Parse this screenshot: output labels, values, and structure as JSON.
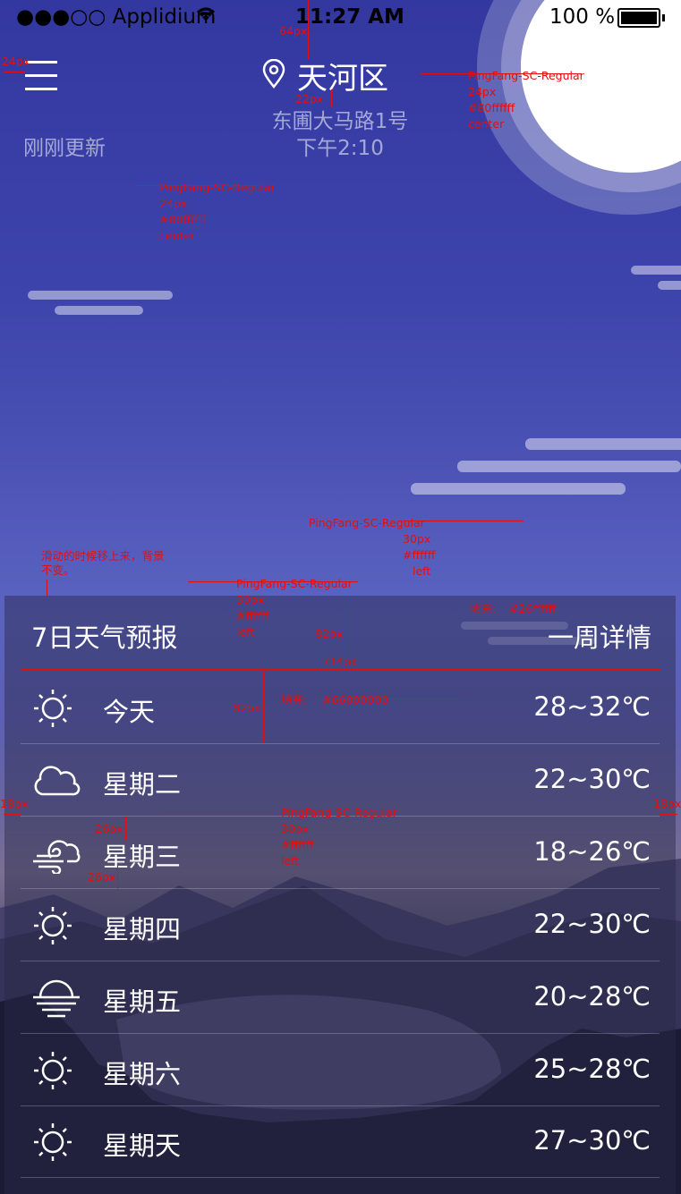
{
  "status_bar": {
    "carrier": "●●●○○ Applidium",
    "time": "11:27 AM",
    "battery": "100 %"
  },
  "header": {
    "city": "天河区",
    "street": "东圃大马路1号",
    "time": "下午2:10",
    "updated": "刚刚更新"
  },
  "forecast": {
    "title": "7日天气预报",
    "detail_link": "一周详情",
    "days": [
      {
        "icon": "sun-icon",
        "day": "今天",
        "temp": "28~32℃"
      },
      {
        "icon": "cloud-icon",
        "day": "星期二",
        "temp": "22~30℃"
      },
      {
        "icon": "cloud-wind-icon",
        "day": "星期三",
        "temp": "18~26℃"
      },
      {
        "icon": "sun-icon",
        "day": "星期四",
        "temp": "22~30℃"
      },
      {
        "icon": "haze-icon",
        "day": "星期五",
        "temp": "20~28℃"
      },
      {
        "icon": "sun-icon",
        "day": "星期六",
        "temp": "25~28℃"
      },
      {
        "icon": "sun-icon",
        "day": "星期天",
        "temp": "27~30℃"
      }
    ]
  },
  "annotations": {
    "a_64": "64px",
    "a_24": "24px",
    "a_22": "22px",
    "font1": "PingFang-SC-Regular",
    "font1_size": "24px",
    "font1_color": "#80ffffff",
    "font1_align": "center",
    "font2": "PingFang-SC-Regular",
    "font2_size": "24px",
    "font2_color": "#80ffffff",
    "font2_align": "center",
    "scroll_note_1": "滑动的时候移上来，背景",
    "scroll_note_2": "不变。",
    "font3": "PingFang-SC-Regular",
    "font3_size": "30px",
    "font3_color": "#ffffff",
    "font3_align": "left",
    "font4": "PingFang-SC-Regular",
    "font4_size": "30px",
    "font4_color": "#ffffff",
    "font4_align": "left",
    "fill1": "填充:",
    "fill1_color": "#26ffffff",
    "a_82a": "82px",
    "a_714": "714px",
    "a_82b": "82px",
    "fill2": "填充:",
    "fill2_color": "#66000000",
    "a_18l": "18px",
    "a_18r": "18px",
    "a_26a": "26px",
    "a_26b": "26px",
    "font5": "PingFang-SC-Regular",
    "font5_size": "30px",
    "font5_color": "#ffffff",
    "font5_align": "left"
  }
}
